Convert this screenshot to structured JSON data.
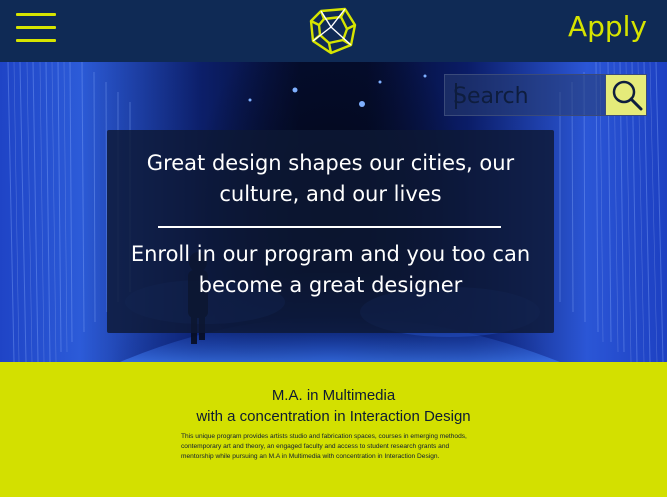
{
  "header": {
    "menu_icon": "hamburger-menu-icon",
    "logo_icon": "wireframe-cube-logo",
    "apply_label": "Apply",
    "accent_color": "#d6e400"
  },
  "search": {
    "placeholder": "Search",
    "icon": "magnifier-icon"
  },
  "hero": {
    "headline": "Great design shapes our cities, our culture, and our lives",
    "subline": "Enroll in our program and you too can become a great designer"
  },
  "program": {
    "title_line1": "M.A. in Multimedia",
    "title_line2": "with a concentration in Interaction Design",
    "description": "This unique program provides artists studio and fabrication spaces, courses in emerging methods, contemporary art and theory, an engaged faculty and access to student research grants and mentorship while pursuing an M.A in Multimedia with concentration in Interaction Design."
  }
}
